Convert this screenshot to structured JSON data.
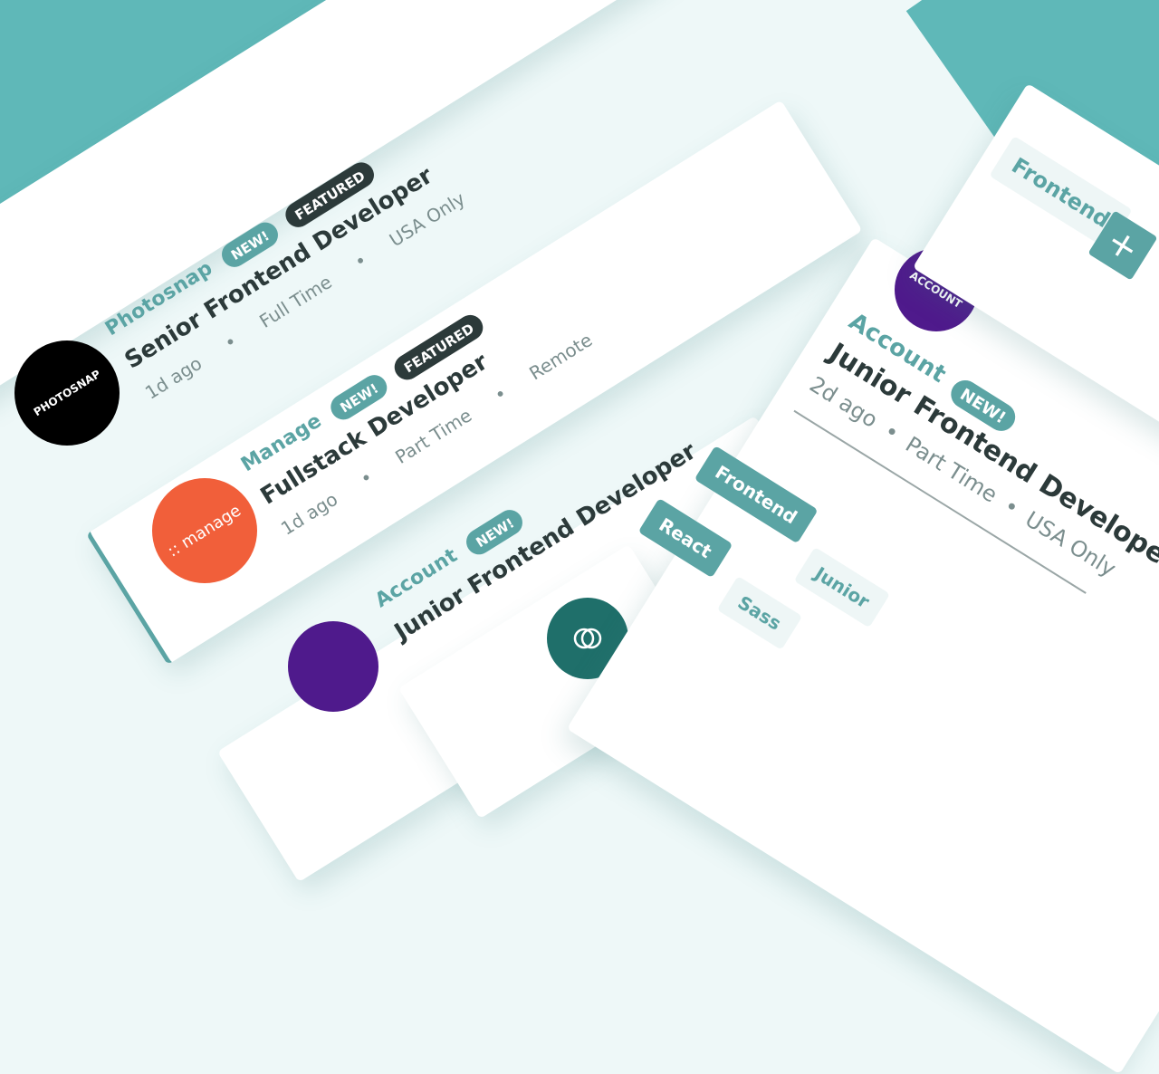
{
  "cards": [
    {
      "company": "Photosnap",
      "new_label": "NEW!",
      "featured_label": "FEATURED",
      "role": "Senior Frontend Developer",
      "posted": "1d ago",
      "contract": "Full Time",
      "location": "USA Only",
      "logo_text": "PHOTOSNAP"
    },
    {
      "company": "Manage",
      "new_label": "NEW!",
      "featured_label": "FEATURED",
      "role": "Fullstack Developer",
      "posted": "1d ago",
      "contract": "Part Time",
      "location": "Remote",
      "logo_text": ":: manage"
    },
    {
      "company": "Account",
      "new_label": "NEW!",
      "role": "Junior Frontend Developer"
    }
  ],
  "detail_card": {
    "company": "Account",
    "new_label": "NEW!",
    "role": "Junior Frontend Developer",
    "posted": "2d ago",
    "contract": "Part Time",
    "location": "USA Only",
    "logo_text": "ACCOUNT",
    "tags": [
      "Frontend",
      "React",
      "Junior",
      "Sass"
    ]
  },
  "filter_panel": {
    "tag": "Frontend",
    "add_symbol": "+"
  },
  "colors": {
    "primary": "#5ba4a4",
    "dark": "#2c3a3a",
    "background": "#eef8f8",
    "photosnap_logo": "#000000",
    "manage_logo": "#f15f3a",
    "account_logo": "#4f1a8c",
    "eyecam_logo": "#1f6f6a"
  }
}
